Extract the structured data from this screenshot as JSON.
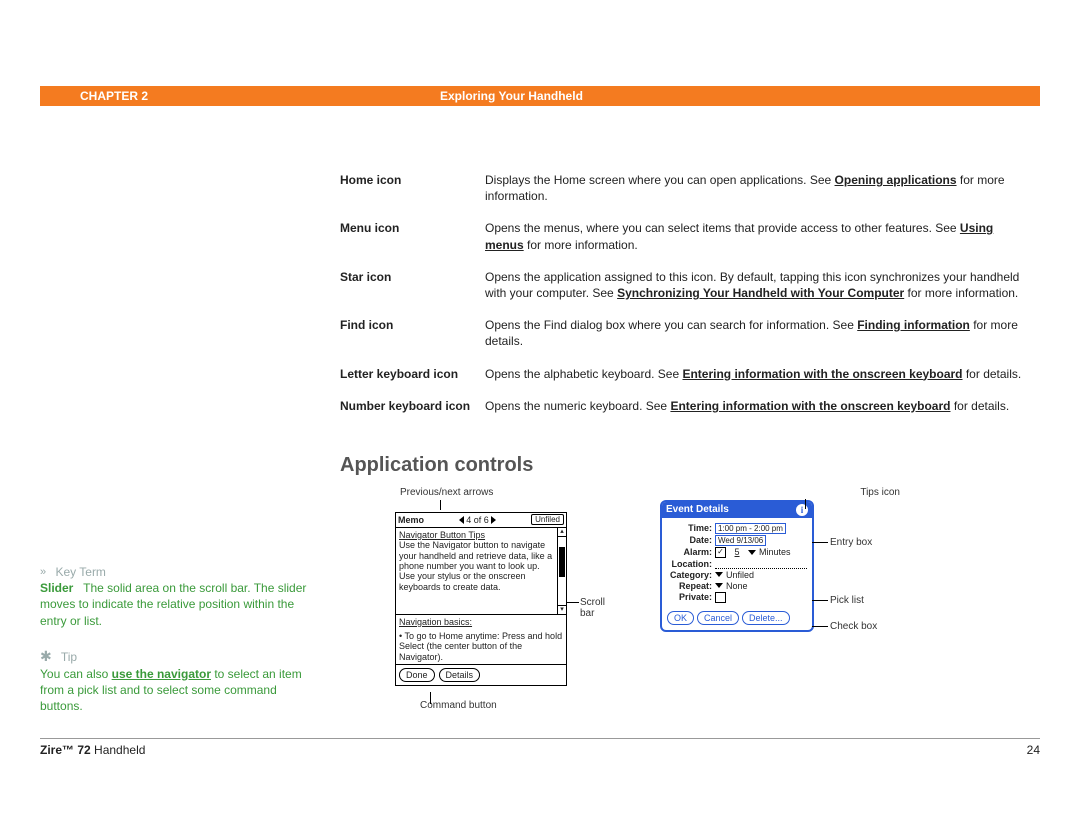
{
  "header": {
    "chapter": "CHAPTER 2",
    "title": "Exploring Your Handheld"
  },
  "defs": [
    {
      "term": "Home icon",
      "pre": "Displays the Home screen where you can open applications. See ",
      "link": "Opening applications",
      "post": " for more information."
    },
    {
      "term": "Menu icon",
      "pre": "Opens the menus, where you can select items that provide access to other features. See ",
      "link": "Using menus",
      "post": " for more information."
    },
    {
      "term": "Star icon",
      "pre": "Opens the application assigned to this icon. By default, tapping this icon synchronizes your handheld with your computer. See ",
      "link": "Synchronizing Your Handheld with Your Computer",
      "post": " for more information."
    },
    {
      "term": "Find icon",
      "pre": "Opens the Find dialog box where you can search for information. See ",
      "link": "Finding information",
      "post": " for more details."
    },
    {
      "term": "Letter keyboard icon",
      "pre": "Opens the alphabetic keyboard. See ",
      "link": "Entering information with the onscreen keyboard",
      "post": " for details."
    },
    {
      "term": "Number keyboard icon",
      "pre": "Opens the numeric keyboard. See ",
      "link": "Entering information with the onscreen keyboard",
      "post": " for details."
    }
  ],
  "section_heading": "Application controls",
  "sidebar": {
    "keyterm_label": "Key Term",
    "keyterm_term": "Slider",
    "keyterm_def": "The solid area on the scroll bar. The slider moves to indicate the relative position within the entry or list.",
    "tip_label": "Tip",
    "tip_pre": "You can also ",
    "tip_link": "use the navigator",
    "tip_post": " to select an item from a pick list and to select some command buttons."
  },
  "fig": {
    "memo": {
      "cap_prevnext": "Previous/next arrows",
      "title": "Memo",
      "counter": "4 of 6",
      "category": "Unfiled",
      "body_h1": "Navigator Button Tips",
      "body_p": "Use the Navigator button to navigate your handheld and retrieve data, like a phone number you want to look up. Use your stylus or the onscreen keyboards to create data.",
      "sec2_h": "Navigation basics:",
      "sec2_li": "• To go to Home anytime: Press and hold Select (the center button of the Navigator).",
      "btn_done": "Done",
      "btn_details": "Details",
      "cap_scrollbar": "Scroll bar",
      "cap_cmdbtn": "Command button"
    },
    "event": {
      "cap_tips": "Tips icon",
      "title": "Event Details",
      "time_l": "Time:",
      "time_v": "1:00 pm - 2:00 pm",
      "date_l": "Date:",
      "date_v": "Wed 9/13/06",
      "alarm_l": "Alarm:",
      "alarm_ck": "✓",
      "alarm_num": "5",
      "alarm_unit": "Minutes",
      "loc_l": "Location:",
      "cat_l": "Category:",
      "cat_v": "Unfiled",
      "rep_l": "Repeat:",
      "rep_v": "None",
      "priv_l": "Private:",
      "ok": "OK",
      "cancel": "Cancel",
      "delete": "Delete...",
      "cap_entry": "Entry box",
      "cap_pick": "Pick list",
      "cap_check": "Check box"
    }
  },
  "footer": {
    "product_b": "Zire™ 72",
    "product_r": " Handheld",
    "page": "24"
  }
}
